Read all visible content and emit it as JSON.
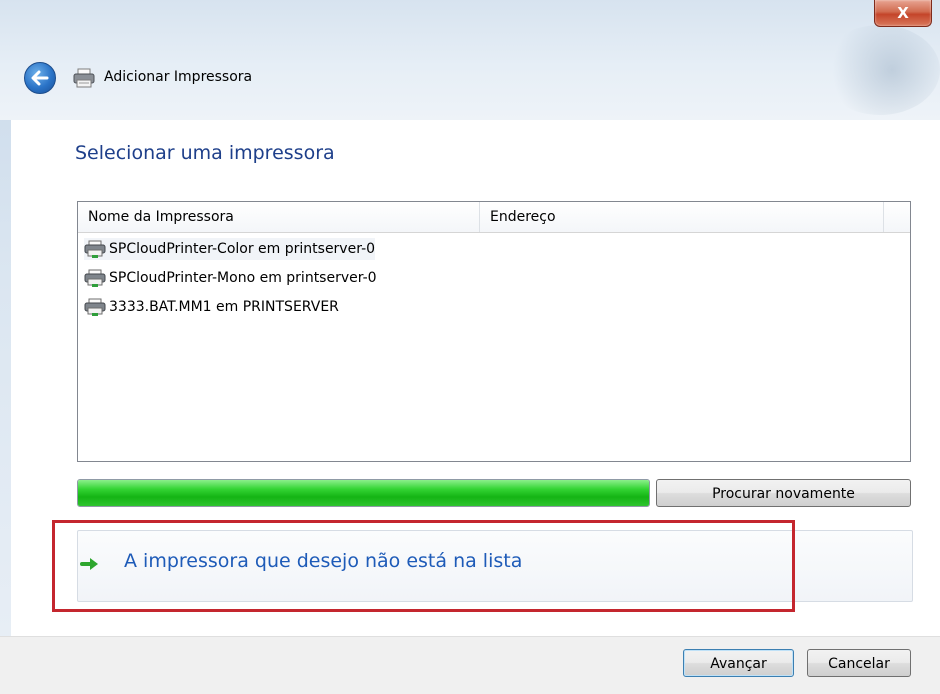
{
  "window": {
    "title": "Adicionar Impressora",
    "close_glyph": "X"
  },
  "page": {
    "heading": "Selecionar uma impressora"
  },
  "printer_list": {
    "columns": [
      "Nome da Impressora",
      "Endereço"
    ],
    "rows": [
      {
        "name": "SPCloudPrinter-Color em printserver-0",
        "address": ""
      },
      {
        "name": "SPCloudPrinter-Mono em printserver-0",
        "address": ""
      },
      {
        "name": "3333.BAT.MM1 em PRINTSERVER",
        "address": ""
      }
    ]
  },
  "search": {
    "progress_fraction": 1.0,
    "search_again_label": "Procurar novamente"
  },
  "link": {
    "not_listed_label": "A impressora que desejo não está na lista"
  },
  "footer": {
    "next_label": "Avançar",
    "cancel_label": "Cancelar"
  },
  "colors": {
    "heading": "#1e3f8a",
    "link": "#1e5bb8",
    "highlight_box": "#c4262e",
    "progress": "#14b414"
  },
  "icons": [
    "back-arrow-icon",
    "printer-icon",
    "green-arrow-icon",
    "close-icon"
  ]
}
